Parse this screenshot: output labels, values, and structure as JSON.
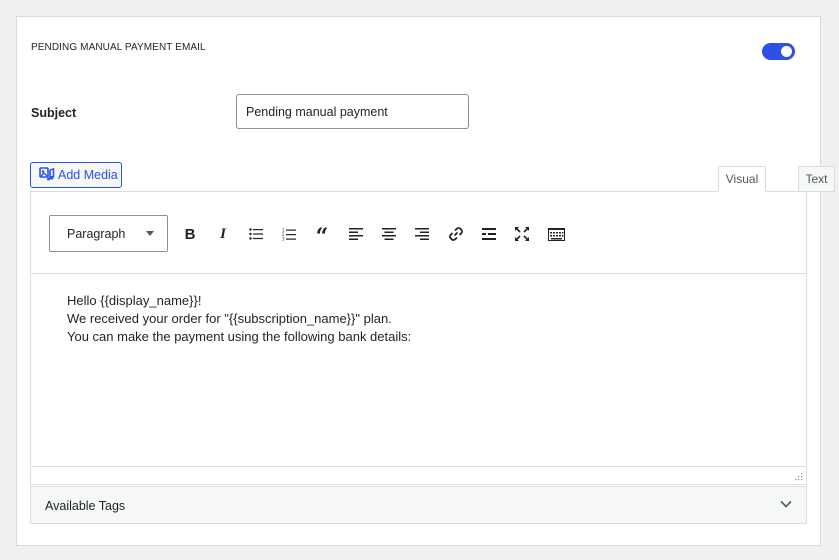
{
  "section": {
    "title": "PENDING MANUAL PAYMENT EMAIL",
    "toggle_on": true,
    "accent_color": "#2d50e6"
  },
  "subject": {
    "label": "Subject",
    "value": "Pending manual payment"
  },
  "editor": {
    "add_media_label": "Add Media",
    "tabs": {
      "visual": "Visual",
      "text": "Text",
      "active": "Visual"
    },
    "format_select": "Paragraph",
    "toolbar_icons": [
      "bold-icon",
      "italic-icon",
      "bullet-list-icon",
      "numbered-list-icon",
      "blockquote-icon",
      "align-left-icon",
      "align-center-icon",
      "align-right-icon",
      "link-icon",
      "read-more-icon",
      "fullscreen-icon",
      "toolbar-toggle-icon"
    ],
    "content_lines": [
      "Hello {{display_name}}!",
      "We received your order for \"{{subscription_name}}\" plan.",
      "You can make the payment using the following bank details:"
    ]
  },
  "available_tags": {
    "label": "Available Tags"
  }
}
